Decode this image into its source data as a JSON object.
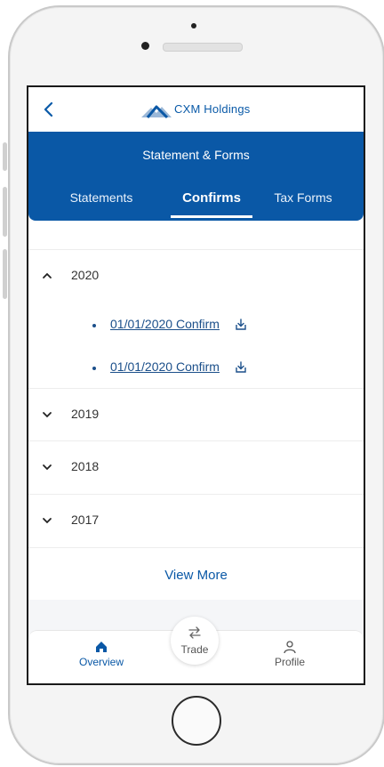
{
  "app": {
    "brand_name": "CXM Holdings",
    "brand_color": "#0a58a6"
  },
  "header": {
    "title": "Statement & Forms"
  },
  "tabs": [
    {
      "label": "Statements",
      "active": false
    },
    {
      "label": "Confirms",
      "active": true
    },
    {
      "label": "Tax Forms",
      "active": false
    }
  ],
  "years": [
    {
      "label": "2020",
      "expanded": true,
      "items": [
        "01/01/2020 Confirm",
        "01/01/2020 Confirm"
      ]
    },
    {
      "label": "2019",
      "expanded": false,
      "items": []
    },
    {
      "label": "2018",
      "expanded": false,
      "items": []
    },
    {
      "label": "2017",
      "expanded": false,
      "items": []
    }
  ],
  "view_more_label": "View More",
  "bottom_nav": {
    "overview": {
      "label": "Overview",
      "icon": "home-icon",
      "active": true
    },
    "trade": {
      "label": "Trade",
      "icon": "swap-arrows-icon"
    },
    "profile": {
      "label": "Profile",
      "icon": "user-icon"
    }
  },
  "icons": {
    "back": "back-chevron-icon",
    "download": "download-icon",
    "expand": "chevron-icon"
  }
}
